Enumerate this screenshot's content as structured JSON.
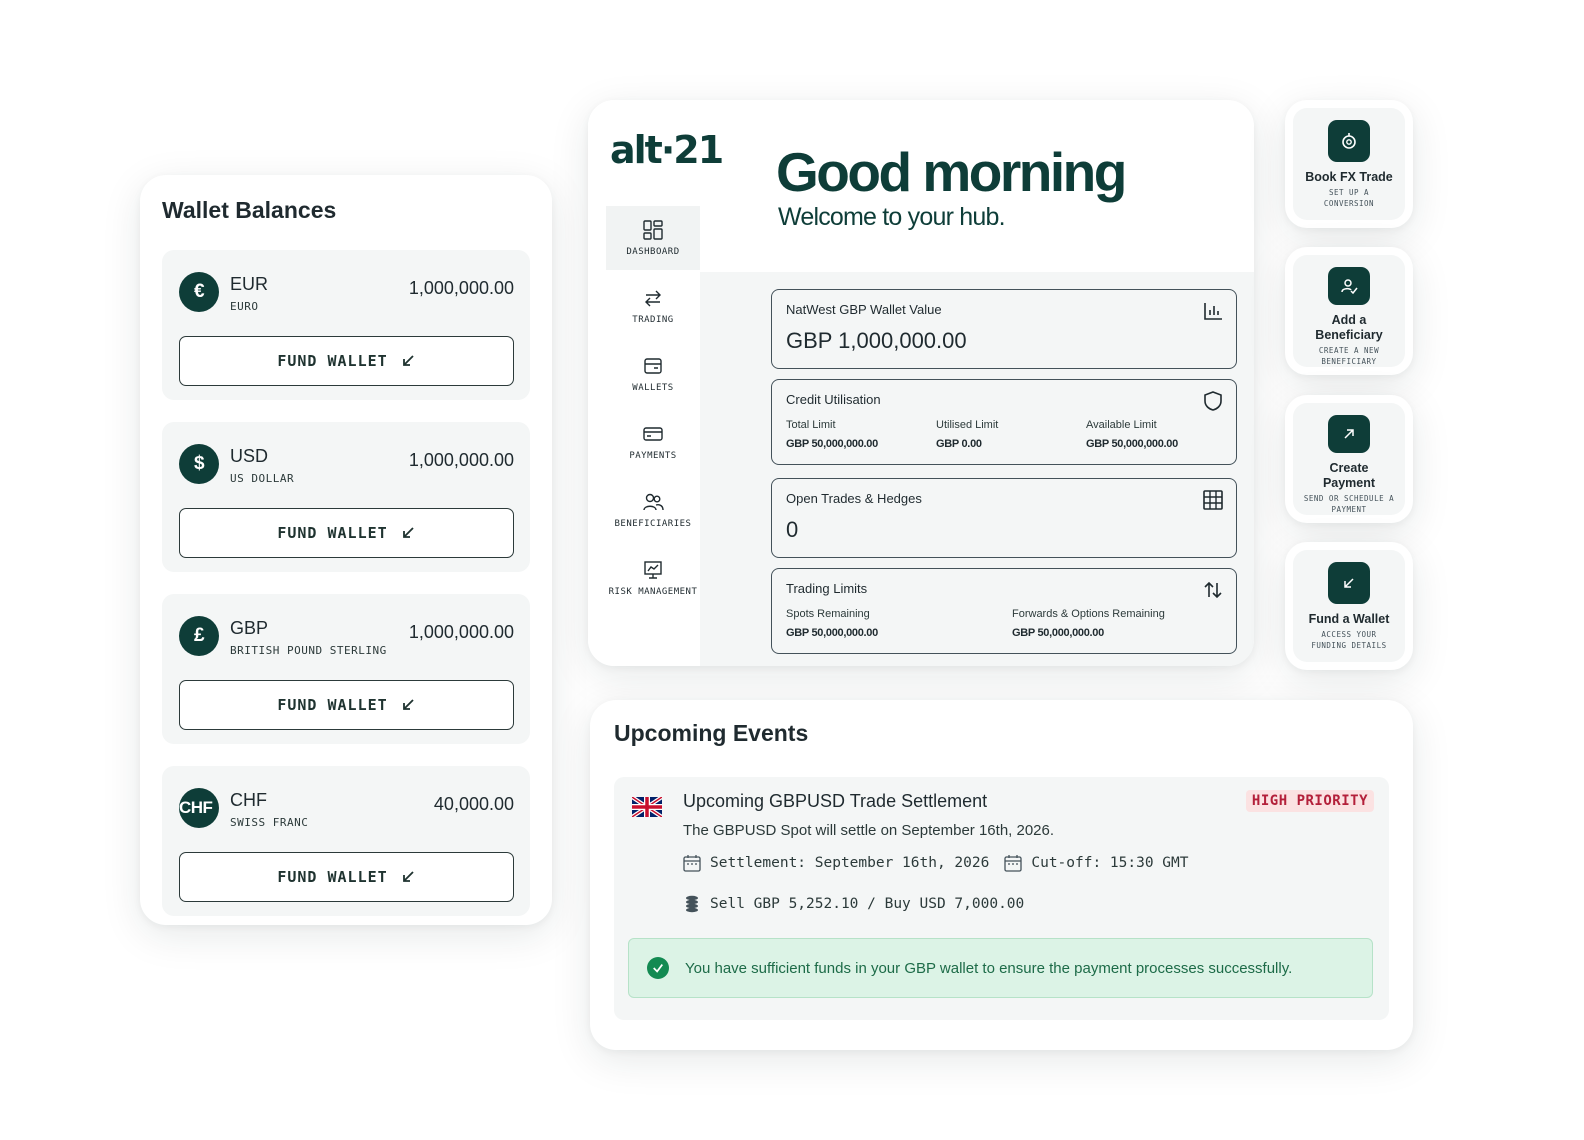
{
  "wallets": {
    "title": "Wallet Balances",
    "fund_label": "FUND WALLET",
    "items": [
      {
        "symbol": "€",
        "code": "EUR",
        "name": "EURO",
        "amount": "1,000,000.00"
      },
      {
        "symbol": "$",
        "code": "USD",
        "name": "US DOLLAR",
        "amount": "1,000,000.00"
      },
      {
        "symbol": "£",
        "code": "GBP",
        "name": "BRITISH POUND STERLING",
        "amount": "1,000,000.00"
      },
      {
        "symbol": "CHF",
        "code": "CHF",
        "name": "SWISS FRANC",
        "amount": "40,000.00"
      }
    ]
  },
  "dashboard": {
    "logo": "alt·21",
    "greeting": "Good morning",
    "subtitle": "Welcome to your hub.",
    "nav": [
      {
        "label": "DASHBOARD",
        "icon": "dashboard-icon"
      },
      {
        "label": "TRADING",
        "icon": "trading-arrows-icon"
      },
      {
        "label": "WALLETS",
        "icon": "wallet-icon"
      },
      {
        "label": "PAYMENTS",
        "icon": "card-icon"
      },
      {
        "label": "BENEFICIARIES",
        "icon": "people-icon"
      },
      {
        "label": "RISK MANAGEMENT",
        "icon": "risk-chart-icon"
      }
    ],
    "wallet_value": {
      "title": "NatWest GBP Wallet Value",
      "value": "GBP 1,000,000.00",
      "icon": "bar-chart-icon"
    },
    "credit": {
      "title": "Credit Utilisation",
      "icon": "shield-icon",
      "total_label": "Total Limit",
      "total_value": "GBP 50,000,000.00",
      "utilised_label": "Utilised Limit",
      "utilised_value": "GBP 0.00",
      "available_label": "Available Limit",
      "available_value": "GBP 50,000,000.00"
    },
    "open_trades": {
      "title": "Open Trades & Hedges",
      "value": "0",
      "icon": "grid-icon"
    },
    "trading_limits": {
      "title": "Trading Limits",
      "icon": "swap-icon",
      "spots_label": "Spots Remaining",
      "spots_value": "GBP 50,000,000.00",
      "fwd_label": "Forwards & Options Remaining",
      "fwd_value": "GBP 50,000,000.00"
    }
  },
  "quick_actions": [
    {
      "title": "Book FX Trade",
      "sub": "SET UP A CONVERSION",
      "icon": "fx-icon"
    },
    {
      "title": "Add a Beneficiary",
      "sub": "CREATE A NEW BENEFICIARY",
      "icon": "add-person-icon"
    },
    {
      "title": "Create Payment",
      "sub": "SEND OR SCHEDULE A PAYMENT",
      "icon": "arrow-up-right-icon"
    },
    {
      "title": "Fund a Wallet",
      "sub": "ACCESS YOUR FUNDING DETAILS",
      "icon": "arrow-down-left-icon"
    }
  ],
  "events": {
    "title": "Upcoming Events",
    "item": {
      "title": "Upcoming GBPUSD Trade Settlement",
      "desc": "The GBPUSD Spot will settle on September 16th, 2026.",
      "priority": "HIGH PRIORITY",
      "settlement": "Settlement: September 16th, 2026",
      "cutoff": "Cut-off: 15:30 GMT",
      "amounts": "Sell GBP 5,252.10 / Buy USD 7,000.00",
      "notice": "You have sufficient funds in your GBP wallet to ensure the payment processes successfully."
    }
  },
  "colors": {
    "brand": "#0e3d38",
    "priority": "#b3203a",
    "success": "#138a52"
  }
}
